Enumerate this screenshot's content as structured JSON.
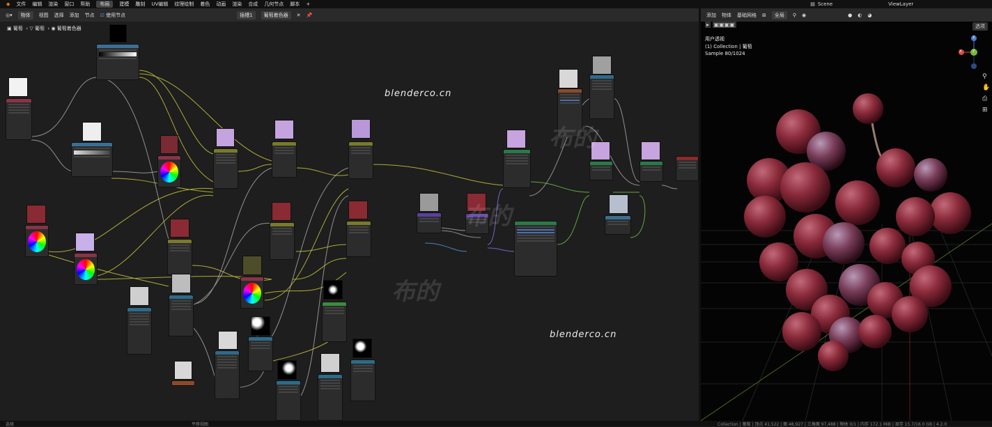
{
  "menu": [
    "文件",
    "编辑",
    "渲染",
    "窗口",
    "帮助"
  ],
  "workspaces": [
    "布局",
    "建模",
    "雕刻",
    "UV编辑",
    "纹理绘制",
    "着色",
    "动画",
    "渲染",
    "合成",
    "几何节点",
    "脚本"
  ],
  "active_workspace": "布局",
  "scene": "Scene",
  "view_layer": "ViewLayer",
  "node_header": {
    "object_mode": "物体",
    "menus": [
      "视图",
      "选择",
      "添加",
      "节点"
    ],
    "use_nodes": "使用节点",
    "slot": "插槽1",
    "material": "葡萄着色器"
  },
  "breadcrumb": [
    "葡萄",
    "葡萄",
    "葡萄着色器"
  ],
  "viewport_header": {
    "menus": [
      "添加",
      "物体",
      "基础网格"
    ],
    "transform": "全局",
    "options": "选项"
  },
  "viewport_overlay": {
    "view": "用户透视",
    "collection": "(1) Collection | 葡萄",
    "sample": "Sample 80/1024"
  },
  "axis_labels": {
    "x": "X",
    "y": "Y",
    "z": "Z"
  },
  "watermarks": {
    "site": "blenderco.cn",
    "brand": "布的"
  },
  "status": {
    "left": "选择",
    "middle": "平移视图",
    "right": "Collection | 葡萄 | 顶点 41,522 | 面 48,927 | 三角面 97,488 | 物体 0/1 | 内存 172.1 MiB | 显存 15.7/16.0 GB | 4.2.0"
  },
  "colors": {
    "shader": "#2a7a48",
    "texture": "#2c6b8a",
    "converter": "#3a6f94",
    "input": "#8b3346",
    "color": "#7a7a2a",
    "vector": "#5a3fa0",
    "group": "#3c8a3c",
    "output": "#8a2a2a"
  }
}
